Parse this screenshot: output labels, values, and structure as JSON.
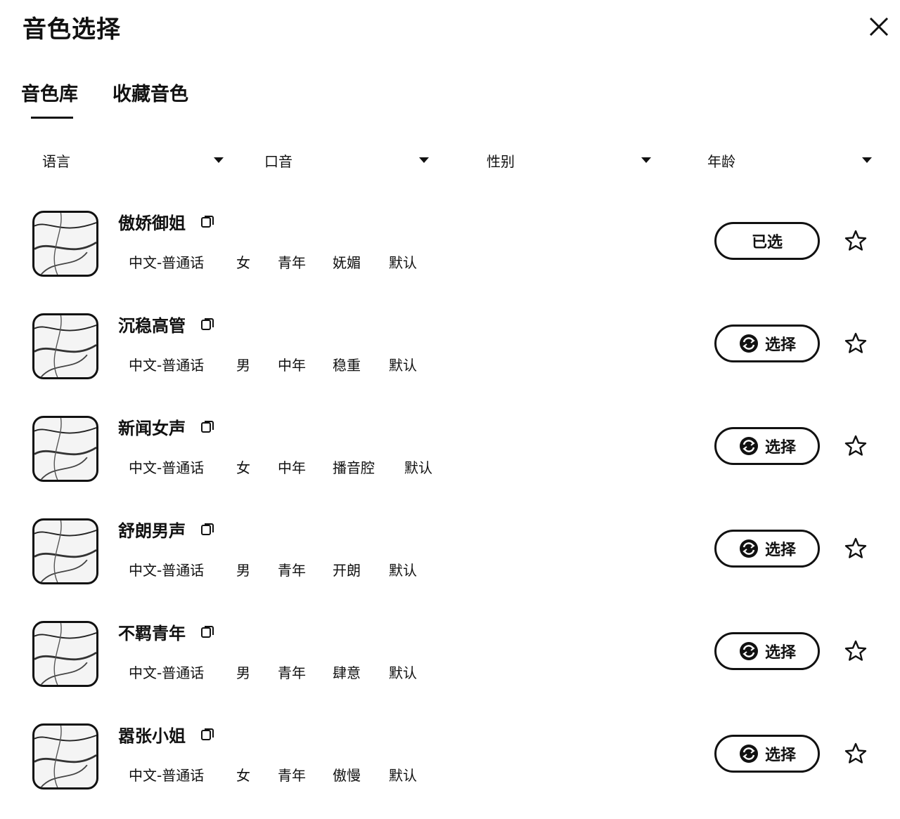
{
  "header": {
    "title": "音色选择",
    "close_icon": "close-icon"
  },
  "tabs": [
    {
      "label": "音色库",
      "active": true
    },
    {
      "label": "收藏音色",
      "active": false
    }
  ],
  "filters": [
    {
      "label": "语言"
    },
    {
      "label": "口音"
    },
    {
      "label": "性别"
    },
    {
      "label": "年龄"
    }
  ],
  "voices": [
    {
      "name": "傲娇御姐",
      "tags": [
        "中文-普通话",
        "女",
        "青年",
        "妩媚",
        "默认"
      ],
      "action": "已选",
      "selected": true
    },
    {
      "name": "沉稳高管",
      "tags": [
        "中文-普通话",
        "男",
        "中年",
        "稳重",
        "默认"
      ],
      "action": "选择",
      "selected": false
    },
    {
      "name": "新闻女声",
      "tags": [
        "中文-普通话",
        "女",
        "中年",
        "播音腔",
        "默认"
      ],
      "action": "选择",
      "selected": false
    },
    {
      "name": "舒朗男声",
      "tags": [
        "中文-普通话",
        "男",
        "青年",
        "开朗",
        "默认"
      ],
      "action": "选择",
      "selected": false
    },
    {
      "name": "不羁青年",
      "tags": [
        "中文-普通话",
        "男",
        "青年",
        "肆意",
        "默认"
      ],
      "action": "选择",
      "selected": false
    },
    {
      "name": "嚣张小姐",
      "tags": [
        "中文-普通话",
        "女",
        "青年",
        "傲慢",
        "默认"
      ],
      "action": "选择",
      "selected": false
    }
  ]
}
